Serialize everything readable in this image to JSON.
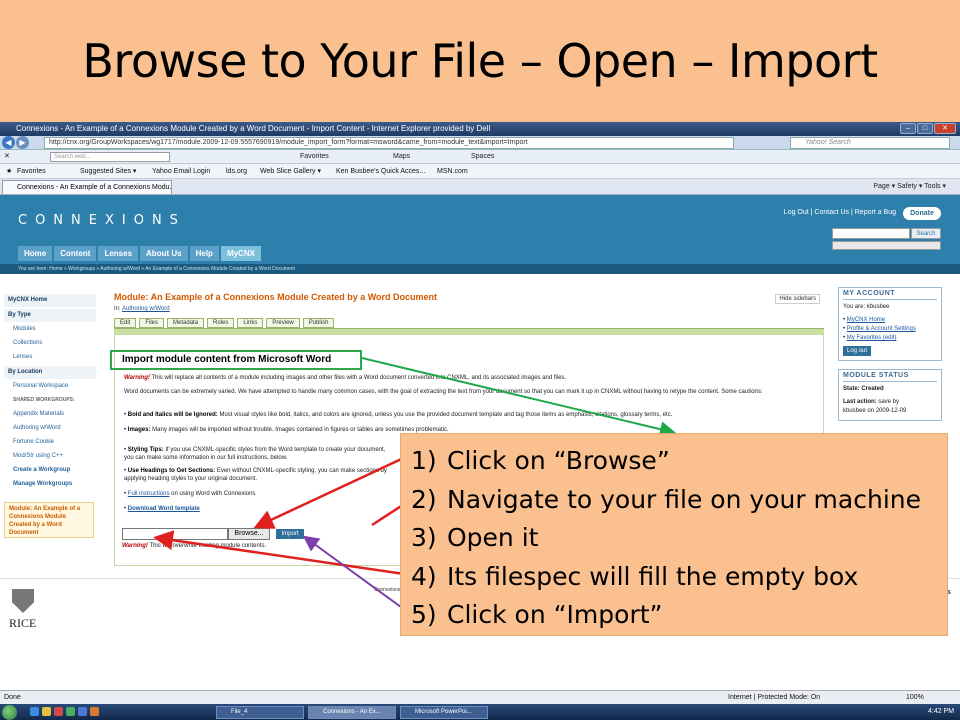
{
  "slide": {
    "title": "Browse to Your File – Open – Import"
  },
  "browser": {
    "window_title": "Connexions - An Example of a Connexions Module Created by a Word Document - Import Content - Internet Explorer provided by Dell",
    "address": "http://cnx.org/GroupWorkspaces/wg1717/module.2009-12-09.5557690919/module_import_form?format=msword&came_from=module_text&import=Import",
    "search_engine_placeholder": "Yahoo! Search",
    "toolbar": {
      "websearch_placeholder": "Search web...",
      "favorites": "Favorites",
      "maps": "Maps",
      "spaces": "Spaces"
    },
    "favorites_bar": [
      "Favorites",
      "Suggested Sites ▾",
      "Yahoo Email Login",
      "lds.org",
      "Web Slice Gallery ▾",
      "Ken Busbee's Quick Acces...",
      "MSN.com"
    ],
    "tab_label": "Connexions - An Example of a Connexions Modu...",
    "tab_tools": "Page ▾   Safety ▾   Tools ▾",
    "status_done": "Done",
    "status_zone": "Internet | Protected Mode: On",
    "zoom": "100%"
  },
  "cnx": {
    "logo": "CONNEXIONS",
    "top_links": "Log Out | Contact Us | Report a Bug",
    "donate": "Donate",
    "search_button": "Search",
    "nav_tabs": [
      "Home",
      "Content",
      "Lenses",
      "About Us",
      "Help",
      "MyCNX"
    ],
    "breadcrumb": "You are here: Home » Workgroups » Authoring w/Word » An Example of a Connexions Module Created by a Word Document",
    "sidebar": {
      "home": "MyCNX Home",
      "by_type": "By Type",
      "type_items": [
        "Modules",
        "Collections",
        "Lenses"
      ],
      "by_location": "By Location",
      "location_items": [
        "Personal Workspace",
        "SHARED WORKGROUPS:",
        "Appendix Materials",
        "Authoring w/Word",
        "Fortune Cookie",
        "Mod/Str using C++",
        "Create a Workgroup",
        "Manage Workgroups"
      ],
      "current": "Module: An Example of a Connexions Module Created by a Word Document"
    },
    "module": {
      "title": "Module: An Example of a Connexions Module Created by a Word Document",
      "in_label": "In:",
      "in_link": "Authoring w/Word",
      "hide_sidebars": "Hide sidebars",
      "edit_tabs": [
        "Edit",
        "Files",
        "Metadata",
        "Roles",
        "Links",
        "Preview",
        "Publish"
      ],
      "heading": "Import module content from Microsoft Word",
      "warning1_label": "Warning!",
      "warning1_text": "This will replace all contents of a module including images and other files with a Word document converted into CNXML, and its associated images and files.",
      "intro": "Word documents can be extremely varied. We have attempted to handle many common cases, with the goal of extracting the text from your document so that you can mark it up in CNXML without having to retype the content. Some cautions:",
      "bullets": [
        {
          "label": "Bold and Italics will be Ignored:",
          "text": "Most visual styles like bold, italics, and colors are ignored, unless you use the provided document template and tag those items as emphasis, citations, glossary terms, etc."
        },
        {
          "label": "Images:",
          "text": "Many images will be imported without trouble. Images contained in figures or tables are sometimes problematic."
        },
        {
          "label": "Styling Tips:",
          "text": "If you use CNXML-specific styles from the Word template to create your document, you can make some information in our full instructions, below."
        },
        {
          "label": "Use Headings to Get Sections:",
          "text": "Even without CNXML-specific styling, you can make sections by applying heading styles to your original document."
        }
      ],
      "full_instructions_link": "Full instructions",
      "full_instructions_rest": "on using Word with Connexions",
      "download_template": "Download Word template",
      "browse_button": "Browse...",
      "import_button": "Import",
      "warning2_label": "Warning!",
      "warning2_text": "This will overwrite existing module contents."
    },
    "account": {
      "title": "MY ACCOUNT",
      "you_are": "You are: kbusbee",
      "links": [
        "MyCNX Home",
        "Profile & Account Settings",
        "My Favorites (edit)"
      ],
      "logout": "Log out"
    },
    "status": {
      "title": "MODULE STATUS",
      "state": "State: Created",
      "last_action_label": "Last action:",
      "last_action_text": "save by",
      "last_action_user": "kbusbee on 2009-12-09"
    },
    "footer": {
      "rice": "RICE",
      "cnx_text": "Connexions",
      "right_text": "s"
    }
  },
  "taskbar": {
    "buttons": [
      "File_4",
      "Connexions - An Ex...",
      "Microsoft PowerPoi..."
    ],
    "clock": "4:42 PM"
  },
  "callout": {
    "steps": [
      {
        "num": "1)",
        "text": "Click on “Browse”"
      },
      {
        "num": "2)",
        "text": "Navigate to your file on your machine"
      },
      {
        "num": "3)",
        "text": "Open it"
      },
      {
        "num": "4)",
        "text": "Its filespec will fill the empty box"
      },
      {
        "num": "5)",
        "text": "Click on “Import”"
      }
    ]
  },
  "colors": {
    "slide_band": "#fac090",
    "cnx_header": "#2d7fac",
    "arrow_green": "#1fa84a",
    "arrow_red": "#e0201e",
    "arrow_purple": "#7a3fa8",
    "module_title": "#d25800"
  }
}
